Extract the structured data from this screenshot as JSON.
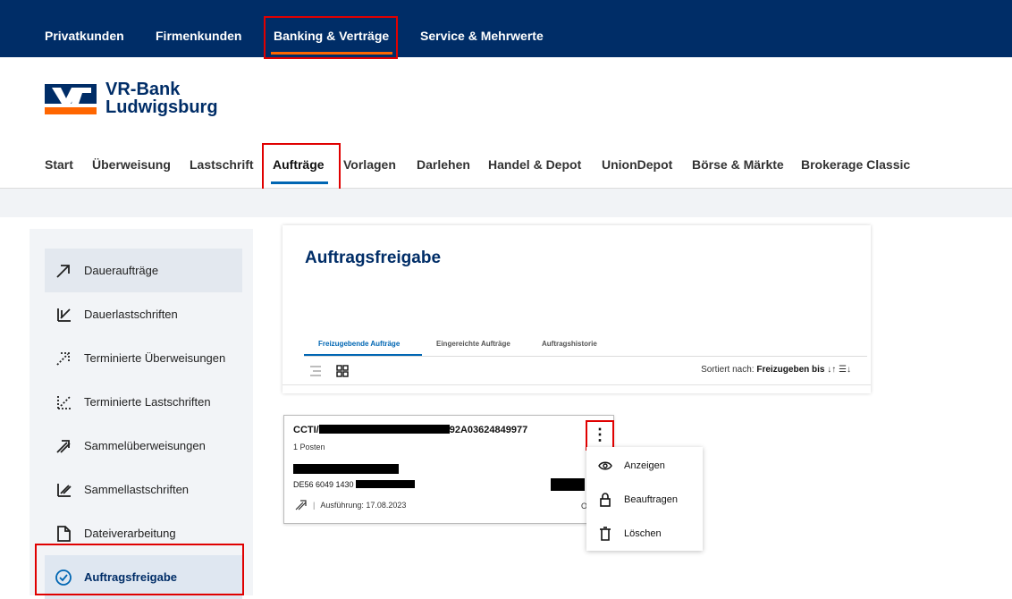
{
  "top_nav": {
    "items": [
      "Privatkunden",
      "Firmenkunden",
      "Banking & Verträge",
      "Service & Mehrwerte"
    ],
    "active_index": 2
  },
  "brand": {
    "line1": "VR-Bank",
    "line2": "Ludwigsburg",
    "color": "#002d67",
    "accent": "#ff6600"
  },
  "sub_nav": {
    "items": [
      "Start",
      "Überweisung",
      "Lastschrift",
      "Aufträge",
      "Vorlagen",
      "Darlehen",
      "Handel & Depot",
      "UnionDepot",
      "Börse & Märkte",
      "Brokerage Classic"
    ],
    "active_index": 3
  },
  "sidebar": {
    "items": [
      {
        "label": "Daueraufträge",
        "icon": "standing-order-icon"
      },
      {
        "label": "Dauerlastschriften",
        "icon": "standing-debit-icon"
      },
      {
        "label": "Terminierte Überweisungen",
        "icon": "scheduled-transfer-icon"
      },
      {
        "label": "Terminierte Lastschriften",
        "icon": "scheduled-debit-icon"
      },
      {
        "label": "Sammelüberweisungen",
        "icon": "batch-transfer-icon"
      },
      {
        "label": "Sammellastschriften",
        "icon": "batch-debit-icon"
      },
      {
        "label": "Dateiverarbeitung",
        "icon": "file-icon"
      },
      {
        "label": "Auftragsfreigabe",
        "icon": "check-circle-icon"
      }
    ],
    "current_index": 7
  },
  "main": {
    "title": "Auftragsfreigabe",
    "tabs": [
      "Freizugebende Aufträge",
      "Eingereichte Aufträge",
      "Auftragshistorie"
    ],
    "active_tab": 0,
    "sort": {
      "prefix": "Sortiert nach:",
      "field": "Freizugeben bis"
    }
  },
  "order": {
    "title_prefix": "CCTI/",
    "title_suffix": "92A03624849977",
    "positions": "1 Posten",
    "iban_prefix": "DE56 6049 1430",
    "execution": "Ausführung: 17.08.2023",
    "trailing": "O"
  },
  "context_menu": {
    "items": [
      {
        "label": "Anzeigen",
        "icon": "eye-icon"
      },
      {
        "label": "Beauftragen",
        "icon": "lock-icon"
      },
      {
        "label": "Löschen",
        "icon": "trash-icon"
      }
    ]
  }
}
